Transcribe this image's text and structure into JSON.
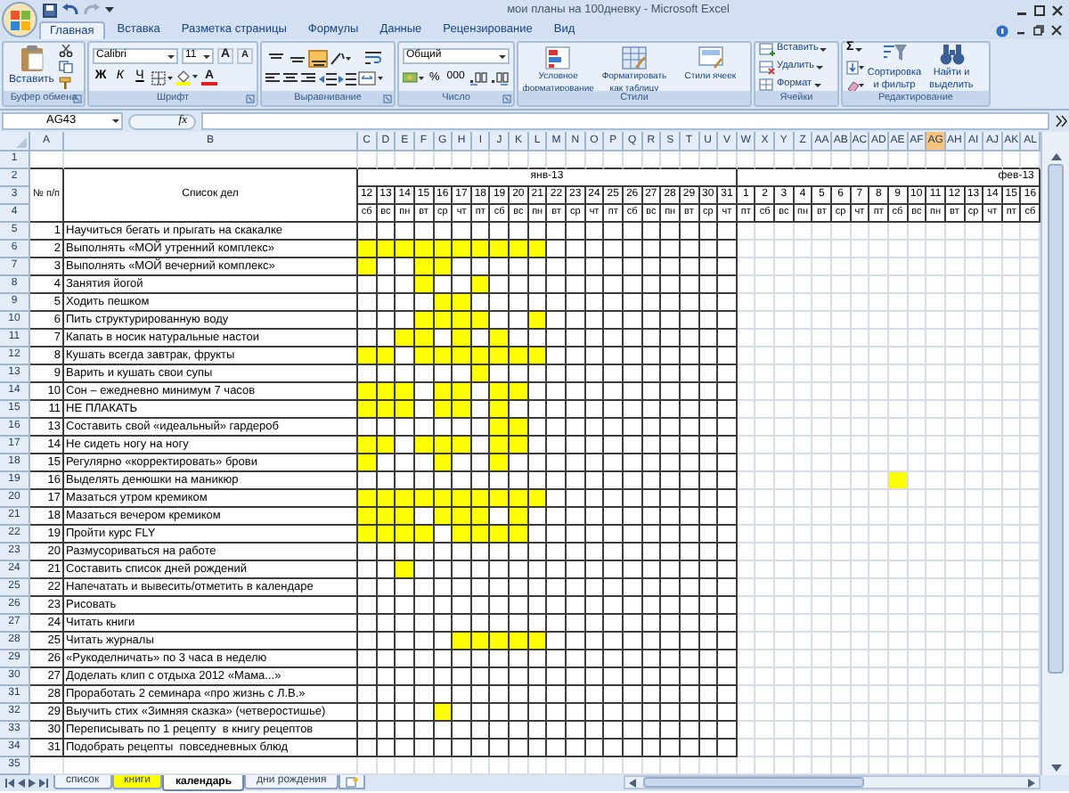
{
  "window": {
    "title": "мои планы на 100дневку - Microsoft Excel"
  },
  "ribbon_tabs": [
    {
      "label": "Главная",
      "selected": true
    },
    {
      "label": "Вставка",
      "selected": false
    },
    {
      "label": "Разметка страницы",
      "selected": false
    },
    {
      "label": "Формулы",
      "selected": false
    },
    {
      "label": "Данные",
      "selected": false
    },
    {
      "label": "Рецензирование",
      "selected": false
    },
    {
      "label": "Вид",
      "selected": false
    }
  ],
  "ribbon": {
    "clipboard": {
      "label": "Буфер обмена",
      "paste": "Вставить"
    },
    "font": {
      "label": "Шрифт",
      "font_name": "Calibri",
      "font_size": "11",
      "grow": "A",
      "shrink": "A",
      "bold": "Ж",
      "italic": "К",
      "underline": "Ч",
      "font_color": "A"
    },
    "alignment": {
      "label": "Выравнивание",
      "vertical_align_buttons": [
        {
          "selected": false
        },
        {
          "selected": false
        },
        {
          "selected": true
        }
      ]
    },
    "number": {
      "label": "Число",
      "format": "Общий",
      "percent": "%",
      "thousands": "000"
    },
    "styles": {
      "label": "Стили",
      "buttons": [
        "Условное форматирование",
        "Форматировать как таблицу",
        "Стили ячеек"
      ]
    },
    "cells": {
      "label": "Ячейки",
      "buttons": [
        "Вставить",
        "Удалить",
        "Формат"
      ]
    },
    "editing": {
      "label": "Редактирование",
      "sum": "Σ",
      "buttons": [
        "Сортировка и фильтр",
        "Найти и выделить"
      ]
    }
  },
  "formula_bar": {
    "name_box": "AG43",
    "function_label": "fx"
  },
  "column_headers": [
    {
      "label": "A",
      "selected": false
    },
    {
      "label": "B",
      "selected": false
    },
    {
      "label": "C",
      "selected": false
    },
    {
      "label": "D",
      "selected": false
    },
    {
      "label": "E",
      "selected": false
    },
    {
      "label": "F",
      "selected": false
    },
    {
      "label": "G",
      "selected": false
    },
    {
      "label": "H",
      "selected": false
    },
    {
      "label": "I",
      "selected": false
    },
    {
      "label": "J",
      "selected": false
    },
    {
      "label": "K",
      "selected": false
    },
    {
      "label": "L",
      "selected": false
    },
    {
      "label": "M",
      "selected": false
    },
    {
      "label": "N",
      "selected": false
    },
    {
      "label": "O",
      "selected": false
    },
    {
      "label": "P",
      "selected": false
    },
    {
      "label": "Q",
      "selected": false
    },
    {
      "label": "R",
      "selected": false
    },
    {
      "label": "S",
      "selected": false
    },
    {
      "label": "T",
      "selected": false
    },
    {
      "label": "U",
      "selected": false
    },
    {
      "label": "V",
      "selected": false
    },
    {
      "label": "W",
      "selected": false
    },
    {
      "label": "X",
      "selected": false
    },
    {
      "label": "Y",
      "selected": false
    },
    {
      "label": "Z",
      "selected": false
    },
    {
      "label": "AA",
      "selected": false
    },
    {
      "label": "AB",
      "selected": false
    },
    {
      "label": "AC",
      "selected": false
    },
    {
      "label": "AD",
      "selected": false
    },
    {
      "label": "AE",
      "selected": false
    },
    {
      "label": "AF",
      "selected": false
    },
    {
      "label": "AG",
      "selected": true
    },
    {
      "label": "AH",
      "selected": false
    },
    {
      "label": "AI",
      "selected": false
    },
    {
      "label": "AJ",
      "selected": false
    },
    {
      "label": "AK",
      "selected": false
    },
    {
      "label": "AL",
      "selected": false
    }
  ],
  "row_numbers": [
    "1",
    "2",
    "3",
    "4",
    "5",
    "6",
    "7",
    "8",
    "9",
    "10",
    "11",
    "12",
    "13",
    "14",
    "15",
    "16",
    "17",
    "18",
    "19",
    "20",
    "21",
    "22",
    "23",
    "24",
    "25",
    "26",
    "27",
    "28",
    "29",
    "30",
    "31",
    "32",
    "33",
    "34",
    "35"
  ],
  "table_header": {
    "number_title": "№ п/п",
    "list_title": "Список дел"
  },
  "months": [
    {
      "label": "янв-13",
      "days": [
        {
          "day": "12",
          "weekday": "сб"
        },
        {
          "day": "13",
          "weekday": "вс"
        },
        {
          "day": "14",
          "weekday": "пн"
        },
        {
          "day": "15",
          "weekday": "вт"
        },
        {
          "day": "16",
          "weekday": "ср"
        },
        {
          "day": "17",
          "weekday": "чт"
        },
        {
          "day": "18",
          "weekday": "пт"
        },
        {
          "day": "19",
          "weekday": "сб"
        },
        {
          "day": "20",
          "weekday": "вс"
        },
        {
          "day": "21",
          "weekday": "пн"
        },
        {
          "day": "22",
          "weekday": "вт"
        },
        {
          "day": "23",
          "weekday": "ср"
        },
        {
          "day": "24",
          "weekday": "чт"
        },
        {
          "day": "25",
          "weekday": "пт"
        },
        {
          "day": "26",
          "weekday": "сб"
        },
        {
          "day": "27",
          "weekday": "вс"
        },
        {
          "day": "28",
          "weekday": "пн"
        },
        {
          "day": "29",
          "weekday": "вт"
        },
        {
          "day": "30",
          "weekday": "ср"
        },
        {
          "day": "31",
          "weekday": "чт"
        }
      ]
    },
    {
      "label": "фев-13",
      "days": [
        {
          "day": "1",
          "weekday": "пт"
        },
        {
          "day": "2",
          "weekday": "сб"
        },
        {
          "day": "3",
          "weekday": "вс"
        },
        {
          "day": "4",
          "weekday": "пн"
        },
        {
          "day": "5",
          "weekday": "вт"
        },
        {
          "day": "6",
          "weekday": "ср"
        },
        {
          "day": "7",
          "weekday": "чт"
        },
        {
          "day": "8",
          "weekday": "пт"
        },
        {
          "day": "9",
          "weekday": "сб"
        },
        {
          "day": "10",
          "weekday": "вс"
        },
        {
          "day": "11",
          "weekday": "пн"
        },
        {
          "day": "12",
          "weekday": "вт"
        },
        {
          "day": "13",
          "weekday": "ср"
        },
        {
          "day": "14",
          "weekday": "чт"
        },
        {
          "day": "15",
          "weekday": "пт"
        },
        {
          "day": "16",
          "weekday": "сб"
        }
      ]
    }
  ],
  "tasks": [
    {
      "number": "1",
      "text": "Научиться бегать и прыгать на скакалке",
      "filled": [
        false,
        false,
        false,
        false,
        false,
        false,
        false,
        false,
        false,
        false,
        false,
        false,
        false,
        false,
        false,
        false,
        false,
        false,
        false,
        false,
        false,
        false,
        false,
        false,
        false,
        false,
        false,
        false,
        false,
        false,
        false,
        false,
        false,
        false,
        false,
        false
      ]
    },
    {
      "number": "2",
      "text": "Выполнять «МОЙ утренний комплекс»",
      "filled": [
        true,
        true,
        true,
        true,
        true,
        true,
        true,
        true,
        true,
        true,
        false,
        false,
        false,
        false,
        false,
        false,
        false,
        false,
        false,
        false,
        false,
        false,
        false,
        false,
        false,
        false,
        false,
        false,
        false,
        false,
        false,
        false,
        false,
        false,
        false,
        false
      ]
    },
    {
      "number": "3",
      "text": "Выполнять «МОЙ вечерний комплекс»",
      "filled": [
        true,
        false,
        false,
        true,
        true,
        false,
        false,
        false,
        false,
        false,
        false,
        false,
        false,
        false,
        false,
        false,
        false,
        false,
        false,
        false,
        false,
        false,
        false,
        false,
        false,
        false,
        false,
        false,
        false,
        false,
        false,
        false,
        false,
        false,
        false,
        false
      ]
    },
    {
      "number": "4",
      "text": "Занятия йогой",
      "filled": [
        false,
        false,
        false,
        true,
        false,
        false,
        true,
        false,
        false,
        false,
        false,
        false,
        false,
        false,
        false,
        false,
        false,
        false,
        false,
        false,
        false,
        false,
        false,
        false,
        false,
        false,
        false,
        false,
        false,
        false,
        false,
        false,
        false,
        false,
        false,
        false
      ]
    },
    {
      "number": "5",
      "text": "Ходить пешком",
      "filled": [
        false,
        false,
        false,
        false,
        true,
        true,
        false,
        false,
        false,
        false,
        false,
        false,
        false,
        false,
        false,
        false,
        false,
        false,
        false,
        false,
        false,
        false,
        false,
        false,
        false,
        false,
        false,
        false,
        false,
        false,
        false,
        false,
        false,
        false,
        false,
        false
      ]
    },
    {
      "number": "6",
      "text": "Пить структурированную воду",
      "filled": [
        false,
        false,
        false,
        true,
        true,
        true,
        true,
        false,
        false,
        true,
        false,
        false,
        false,
        false,
        false,
        false,
        false,
        false,
        false,
        false,
        false,
        false,
        false,
        false,
        false,
        false,
        false,
        false,
        false,
        false,
        false,
        false,
        false,
        false,
        false,
        false
      ]
    },
    {
      "number": "7",
      "text": "Капать в носик натуральные настои",
      "filled": [
        false,
        false,
        true,
        true,
        false,
        true,
        false,
        true,
        false,
        false,
        false,
        false,
        false,
        false,
        false,
        false,
        false,
        false,
        false,
        false,
        false,
        false,
        false,
        false,
        false,
        false,
        false,
        false,
        false,
        false,
        false,
        false,
        false,
        false,
        false,
        false
      ]
    },
    {
      "number": "8",
      "text": "Кушать всегда завтрак, фрукты",
      "filled": [
        true,
        true,
        false,
        true,
        true,
        true,
        true,
        true,
        true,
        true,
        false,
        false,
        false,
        false,
        false,
        false,
        false,
        false,
        false,
        false,
        false,
        false,
        false,
        false,
        false,
        false,
        false,
        false,
        false,
        false,
        false,
        false,
        false,
        false,
        false,
        false
      ]
    },
    {
      "number": "9",
      "text": "Варить и кушать свои супы",
      "filled": [
        false,
        false,
        false,
        false,
        false,
        false,
        true,
        false,
        false,
        false,
        false,
        false,
        false,
        false,
        false,
        false,
        false,
        false,
        false,
        false,
        false,
        false,
        false,
        false,
        false,
        false,
        false,
        false,
        false,
        false,
        false,
        false,
        false,
        false,
        false,
        false
      ]
    },
    {
      "number": "10",
      "text": "Сон – ежедневно минимум 7 часов",
      "filled": [
        true,
        true,
        true,
        false,
        true,
        true,
        false,
        true,
        true,
        false,
        false,
        false,
        false,
        false,
        false,
        false,
        false,
        false,
        false,
        false,
        false,
        false,
        false,
        false,
        false,
        false,
        false,
        false,
        false,
        false,
        false,
        false,
        false,
        false,
        false,
        false
      ]
    },
    {
      "number": "11",
      "text": "НЕ ПЛАКАТЬ",
      "filled": [
        true,
        true,
        true,
        false,
        true,
        true,
        false,
        true,
        false,
        false,
        false,
        false,
        false,
        false,
        false,
        false,
        false,
        false,
        false,
        false,
        false,
        false,
        false,
        false,
        false,
        false,
        false,
        false,
        false,
        false,
        false,
        false,
        false,
        false,
        false,
        false
      ]
    },
    {
      "number": "13",
      "text": "Составить свой «идеальный» гардероб",
      "filled": [
        false,
        false,
        false,
        false,
        false,
        false,
        false,
        true,
        true,
        false,
        false,
        false,
        false,
        false,
        false,
        false,
        false,
        false,
        false,
        false,
        false,
        false,
        false,
        false,
        false,
        false,
        false,
        false,
        false,
        false,
        false,
        false,
        false,
        false,
        false,
        false
      ]
    },
    {
      "number": "14",
      "text": "Не сидеть ногу на ногу",
      "filled": [
        true,
        true,
        false,
        true,
        true,
        true,
        false,
        true,
        true,
        false,
        false,
        false,
        false,
        false,
        false,
        false,
        false,
        false,
        false,
        false,
        false,
        false,
        false,
        false,
        false,
        false,
        false,
        false,
        false,
        false,
        false,
        false,
        false,
        false,
        false,
        false
      ]
    },
    {
      "number": "15",
      "text": "Регулярно «корректировать» брови",
      "filled": [
        true,
        false,
        false,
        false,
        true,
        false,
        false,
        true,
        false,
        false,
        false,
        false,
        false,
        false,
        false,
        false,
        false,
        false,
        false,
        false,
        false,
        false,
        false,
        false,
        false,
        false,
        false,
        false,
        false,
        false,
        false,
        false,
        false,
        false,
        false,
        false
      ]
    },
    {
      "number": "16",
      "text": "Выделять денюшки на маникюр",
      "filled": [
        false,
        false,
        false,
        false,
        false,
        false,
        false,
        false,
        false,
        false,
        false,
        false,
        false,
        false,
        false,
        false,
        false,
        false,
        false,
        false,
        false,
        false,
        false,
        false,
        false,
        false,
        false,
        false,
        true,
        false,
        false,
        false,
        false,
        false,
        false,
        false
      ]
    },
    {
      "number": "17",
      "text": "Мазаться утром кремиком",
      "filled": [
        true,
        true,
        true,
        true,
        true,
        true,
        true,
        true,
        true,
        true,
        false,
        false,
        false,
        false,
        false,
        false,
        false,
        false,
        false,
        false,
        false,
        false,
        false,
        false,
        false,
        false,
        false,
        false,
        false,
        false,
        false,
        false,
        false,
        false,
        false,
        false
      ]
    },
    {
      "number": "18",
      "text": "Мазаться вечером кремиком",
      "filled": [
        true,
        true,
        true,
        false,
        true,
        true,
        true,
        false,
        true,
        false,
        false,
        false,
        false,
        false,
        false,
        false,
        false,
        false,
        false,
        false,
        false,
        false,
        false,
        false,
        false,
        false,
        false,
        false,
        false,
        false,
        false,
        false,
        false,
        false,
        false,
        false
      ]
    },
    {
      "number": "19",
      "text": "Пройти курс FLY",
      "filled": [
        true,
        true,
        true,
        true,
        false,
        true,
        true,
        true,
        true,
        false,
        false,
        false,
        false,
        false,
        false,
        false,
        false,
        false,
        false,
        false,
        false,
        false,
        false,
        false,
        false,
        false,
        false,
        false,
        false,
        false,
        false,
        false,
        false,
        false,
        false,
        false
      ]
    },
    {
      "number": "20",
      "text": "Размусориваться на работе",
      "filled": [
        false,
        false,
        false,
        false,
        false,
        false,
        false,
        false,
        false,
        false,
        false,
        false,
        false,
        false,
        false,
        false,
        false,
        false,
        false,
        false,
        false,
        false,
        false,
        false,
        false,
        false,
        false,
        false,
        false,
        false,
        false,
        false,
        false,
        false,
        false,
        false
      ]
    },
    {
      "number": "21",
      "text": "Составить список дней рождений",
      "filled": [
        false,
        false,
        true,
        false,
        false,
        false,
        false,
        false,
        false,
        false,
        false,
        false,
        false,
        false,
        false,
        false,
        false,
        false,
        false,
        false,
        false,
        false,
        false,
        false,
        false,
        false,
        false,
        false,
        false,
        false,
        false,
        false,
        false,
        false,
        false,
        false
      ]
    },
    {
      "number": "22",
      "text": "Напечатать и вывесить/отметить в календаре",
      "filled": [
        false,
        false,
        false,
        false,
        false,
        false,
        false,
        false,
        false,
        false,
        false,
        false,
        false,
        false,
        false,
        false,
        false,
        false,
        false,
        false,
        false,
        false,
        false,
        false,
        false,
        false,
        false,
        false,
        false,
        false,
        false,
        false,
        false,
        false,
        false,
        false
      ]
    },
    {
      "number": "23",
      "text": "Рисовать",
      "filled": [
        false,
        false,
        false,
        false,
        false,
        false,
        false,
        false,
        false,
        false,
        false,
        false,
        false,
        false,
        false,
        false,
        false,
        false,
        false,
        false,
        false,
        false,
        false,
        false,
        false,
        false,
        false,
        false,
        false,
        false,
        false,
        false,
        false,
        false,
        false,
        false
      ]
    },
    {
      "number": "24",
      "text": "Читать книги",
      "filled": [
        false,
        false,
        false,
        false,
        false,
        false,
        false,
        false,
        false,
        false,
        false,
        false,
        false,
        false,
        false,
        false,
        false,
        false,
        false,
        false,
        false,
        false,
        false,
        false,
        false,
        false,
        false,
        false,
        false,
        false,
        false,
        false,
        false,
        false,
        false,
        false
      ]
    },
    {
      "number": "25",
      "text": "Читать журналы",
      "filled": [
        false,
        false,
        false,
        false,
        false,
        true,
        true,
        true,
        true,
        true,
        false,
        false,
        false,
        false,
        false,
        false,
        false,
        false,
        false,
        false,
        false,
        false,
        false,
        false,
        false,
        false,
        false,
        false,
        false,
        false,
        false,
        false,
        false,
        false,
        false,
        false
      ]
    },
    {
      "number": "26",
      "text": "«Рукоделничать» по 3 часа в неделю",
      "filled": [
        false,
        false,
        false,
        false,
        false,
        false,
        false,
        false,
        false,
        false,
        false,
        false,
        false,
        false,
        false,
        false,
        false,
        false,
        false,
        false,
        false,
        false,
        false,
        false,
        false,
        false,
        false,
        false,
        false,
        false,
        false,
        false,
        false,
        false,
        false,
        false
      ]
    },
    {
      "number": "27",
      "text": "Доделать клип с отдыха 2012 «Мама...»",
      "filled": [
        false,
        false,
        false,
        false,
        false,
        false,
        false,
        false,
        false,
        false,
        false,
        false,
        false,
        false,
        false,
        false,
        false,
        false,
        false,
        false,
        false,
        false,
        false,
        false,
        false,
        false,
        false,
        false,
        false,
        false,
        false,
        false,
        false,
        false,
        false,
        false
      ]
    },
    {
      "number": "28",
      "text": "Проработать 2 семинара «про жизнь с Л.В.»",
      "filled": [
        false,
        false,
        false,
        false,
        false,
        false,
        false,
        false,
        false,
        false,
        false,
        false,
        false,
        false,
        false,
        false,
        false,
        false,
        false,
        false,
        false,
        false,
        false,
        false,
        false,
        false,
        false,
        false,
        false,
        false,
        false,
        false,
        false,
        false,
        false,
        false
      ]
    },
    {
      "number": "29",
      "text": "Выучить стих «Зимняя сказка» (четверостишье)",
      "filled": [
        false,
        false,
        false,
        false,
        true,
        false,
        false,
        false,
        false,
        false,
        false,
        false,
        false,
        false,
        false,
        false,
        false,
        false,
        false,
        false,
        false,
        false,
        false,
        false,
        false,
        false,
        false,
        false,
        false,
        false,
        false,
        false,
        false,
        false,
        false,
        false
      ]
    },
    {
      "number": "30",
      "text": "Переписывать по 1 рецепту  в книгу рецептов",
      "filled": [
        false,
        false,
        false,
        false,
        false,
        false,
        false,
        false,
        false,
        false,
        false,
        false,
        false,
        false,
        false,
        false,
        false,
        false,
        false,
        false,
        false,
        false,
        false,
        false,
        false,
        false,
        false,
        false,
        false,
        false,
        false,
        false,
        false,
        false,
        false,
        false
      ]
    },
    {
      "number": "31",
      "text": "Подобрать рецепты  повседневных блюд",
      "filled": [
        false,
        false,
        false,
        false,
        false,
        false,
        false,
        false,
        false,
        false,
        false,
        false,
        false,
        false,
        false,
        false,
        false,
        false,
        false,
        false,
        false,
        false,
        false,
        false,
        false,
        false,
        false,
        false,
        false,
        false,
        false,
        false,
        false,
        false,
        false,
        false
      ]
    }
  ],
  "sheet_tabs": [
    {
      "label": "список",
      "selected": false
    },
    {
      "label": "книги",
      "selected": false,
      "color": "#ffff00"
    },
    {
      "label": "календарь",
      "selected": true
    },
    {
      "label": "дни рождения",
      "selected": false
    }
  ]
}
